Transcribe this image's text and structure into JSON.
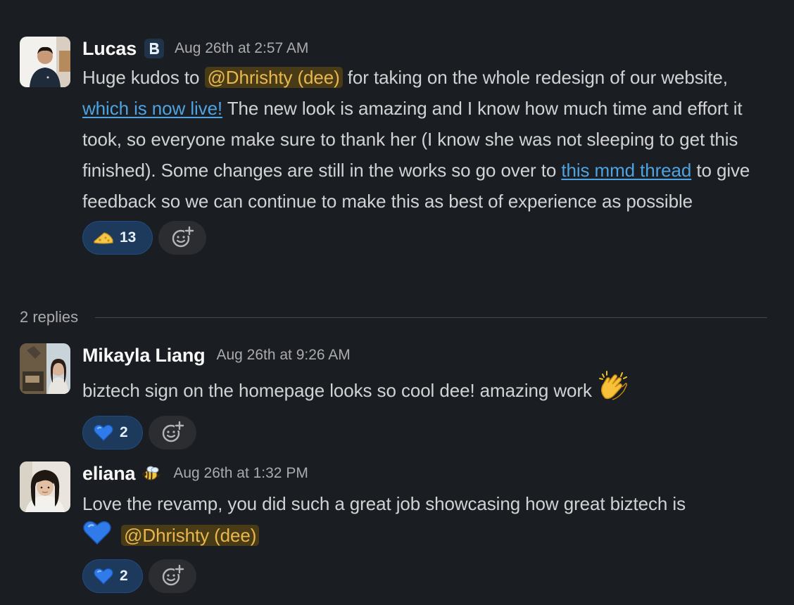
{
  "thread_parent": {
    "author": "Lucas",
    "author_badge_icon": "biztech-logo-icon",
    "timestamp": "Aug 26th at 2:57 AM",
    "text": {
      "part1": "Huge kudos to ",
      "mention": "@Dhrishty (dee)",
      "part2": " for taking on the whole redesign of our website, ",
      "link1": "which is now live!",
      "part3": " The new look is amazing and I know how much time and effort it took, so everyone make sure to thank her (I know she was not sleeping to get this finished). Some changes are still in the works so go over to ",
      "link2": "this mmd thread",
      "part4": " to give feedback so we can continue to make this as best of experience as possible"
    },
    "reactions": [
      {
        "emoji": "cheese-icon",
        "count": "13"
      }
    ]
  },
  "replies_divider": {
    "label": "2 replies"
  },
  "replies": [
    {
      "author": "Mikayla Liang",
      "timestamp": "Aug 26th at 9:26 AM",
      "text": "biztech sign on the homepage looks so cool dee! amazing work ",
      "trailing_emoji": "clapping-hands-icon",
      "reactions": [
        {
          "emoji": "blue-heart-icon",
          "count": "2"
        }
      ]
    },
    {
      "author": "eliana",
      "author_badge_icon": "bee-icon",
      "timestamp": "Aug 26th at 1:32 PM",
      "text": "Love the revamp, you did such a great job showcasing how great biztech is",
      "inline_emoji": "blue-heart-icon",
      "mention": "@Dhrishty (dee)",
      "reactions": [
        {
          "emoji": "blue-heart-icon",
          "count": "2"
        }
      ]
    }
  ],
  "colors": {
    "background": "#1a1d21",
    "mention_bg": "#4a3b17",
    "mention_text": "#e8b84f",
    "link": "#4fa3e0",
    "reaction_bg": "#1d3a5c"
  }
}
